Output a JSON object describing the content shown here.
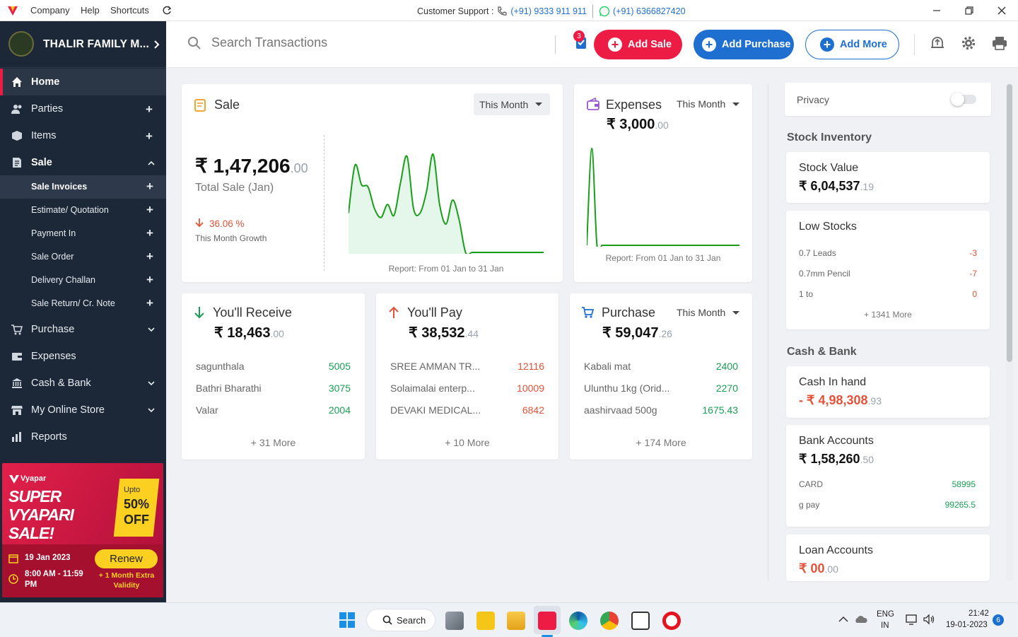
{
  "window": {
    "menu": [
      "Company",
      "Help",
      "Shortcuts"
    ],
    "support_label": "Customer Support :",
    "support_phone": "(+91) 9333 911 911",
    "support_whatsapp": "(+91) 6366827420"
  },
  "sidebar": {
    "company_name": "THALIR FAMILY M...",
    "items": [
      {
        "label": "Home",
        "icon": "home-icon"
      },
      {
        "label": "Parties",
        "icon": "people-icon"
      },
      {
        "label": "Items",
        "icon": "box-icon"
      },
      {
        "label": "Sale",
        "icon": "invoice-icon"
      },
      {
        "label": "Purchase",
        "icon": "cart-icon"
      },
      {
        "label": "Expenses",
        "icon": "wallet-icon"
      },
      {
        "label": "Cash & Bank",
        "icon": "bank-icon"
      },
      {
        "label": "My Online Store",
        "icon": "store-icon"
      },
      {
        "label": "Reports",
        "icon": "chart-icon"
      }
    ],
    "sale_sub": [
      "Sale Invoices",
      "Estimate/ Quotation",
      "Payment In",
      "Sale Order",
      "Delivery Challan",
      "Sale Return/ Cr. Note"
    ],
    "promo": {
      "brand": "Vyapar",
      "headline1": "SUPER",
      "headline2": "VYAPARI",
      "headline3": "SALE!",
      "offer_upto": "Upto",
      "offer_pct": "50%",
      "offer_off": "OFF",
      "date": "19 Jan 2023",
      "time": "8:00 AM - 11:59 PM",
      "renew": "Renew",
      "extra": "+ 1 Month Extra Validity"
    }
  },
  "topbar": {
    "search_placeholder": "Search Transactions",
    "notif_count": "3",
    "add_sale": "Add Sale",
    "add_purchase": "Add Purchase",
    "add_more": "Add More"
  },
  "sale": {
    "title": "Sale",
    "period": "This Month",
    "total_main": "₹ 1,47,206",
    "total_dec": ".00",
    "total_label": "Total Sale (Jan)",
    "growth": "36.06 %",
    "growth_label": "This Month Growth",
    "report": "Report: From 01 Jan to 31 Jan"
  },
  "expenses": {
    "title": "Expenses",
    "period": "This Month",
    "amount_main": "₹ 3,000",
    "amount_dec": ".00",
    "report": "Report: From 01 Jan to 31 Jan"
  },
  "receive": {
    "title": "You'll Receive",
    "amount_main": "₹ 18,463",
    "amount_dec": ".00",
    "rows": [
      {
        "name": "sagunthala",
        "value": "5005"
      },
      {
        "name": "Bathri Bharathi",
        "value": "3075"
      },
      {
        "name": "Valar",
        "value": "2004"
      }
    ],
    "more": "+ 31 More"
  },
  "pay": {
    "title": "You'll Pay",
    "amount_main": "₹ 38,532",
    "amount_dec": ".44",
    "rows": [
      {
        "name": "SREE AMMAN TR...",
        "value": "12116"
      },
      {
        "name": "Solaimalai enterp...",
        "value": "10009"
      },
      {
        "name": "DEVAKI MEDICAL...",
        "value": "6842"
      }
    ],
    "more": "+ 10 More"
  },
  "purchase": {
    "title": "Purchase",
    "period": "This Month",
    "amount_main": "₹ 59,047",
    "amount_dec": ".26",
    "rows": [
      {
        "name": "Kabali mat",
        "value": "2400"
      },
      {
        "name": "Ulunthu 1kg (Orid...",
        "value": "2270"
      },
      {
        "name": "aashirvaad 500g",
        "value": "1675.43"
      }
    ],
    "more": "+ 174 More"
  },
  "right": {
    "privacy": "Privacy",
    "stock_title": "Stock Inventory",
    "stock_value_label": "Stock Value",
    "stock_value_main": "₹ 6,04,537",
    "stock_value_dec": ".19",
    "low_stocks_label": "Low Stocks",
    "low_stocks": [
      {
        "name": "0.7 Leads",
        "value": "-3"
      },
      {
        "name": "0.7mm Pencil",
        "value": "-7"
      },
      {
        "name": "1 to",
        "value": "0"
      }
    ],
    "low_more": "+ 1341 More",
    "cash_title": "Cash & Bank",
    "cash_label": "Cash In hand",
    "cash_main": "- ₹ 4,98,308",
    "cash_dec": ".93",
    "bank_label": "Bank Accounts",
    "bank_main": "₹ 1,58,260",
    "bank_dec": ".50",
    "banks": [
      {
        "name": "CARD",
        "value": "58995"
      },
      {
        "name": "g pay",
        "value": "99265.5"
      }
    ],
    "loan_label": "Loan Accounts",
    "loan_main": "₹ 00",
    "loan_dec": ".00"
  },
  "taskbar": {
    "search": "Search",
    "lang1": "ENG",
    "lang2": "IN",
    "time": "21:42",
    "date": "19-01-2023",
    "notif": "6"
  },
  "colors": {
    "sidebar": "#1c2838",
    "accent": "#ed1c45",
    "blue": "#1f6fd1",
    "green": "#1a9e55",
    "red": "#e4523a"
  },
  "chart_data": [
    {
      "type": "area",
      "title": "",
      "x": [
        "1",
        "2",
        "3",
        "4",
        "5",
        "6",
        "7",
        "8",
        "9",
        "10",
        "11",
        "12",
        "13",
        "14",
        "15",
        "16",
        "17",
        "18",
        "19",
        "20",
        "21",
        "22",
        "23",
        "24",
        "25",
        "26",
        "27",
        "28",
        "29",
        "30",
        "31"
      ],
      "values": [
        18000,
        40000,
        31000,
        30000,
        20000,
        16000,
        22000,
        17000,
        32000,
        44000,
        20000,
        18000,
        28000,
        45000,
        22000,
        13000,
        24000,
        15000,
        0,
        0,
        0,
        0,
        0,
        0,
        0,
        0,
        0,
        0,
        0,
        0,
        0
      ],
      "color": "#1a9e1a"
    },
    {
      "type": "line",
      "title": "",
      "x": [
        "1",
        "2",
        "3",
        "4",
        "5",
        "6",
        "7",
        "8",
        "9",
        "10",
        "11",
        "12",
        "13",
        "14",
        "15",
        "16",
        "17",
        "18",
        "19",
        "20",
        "21",
        "22",
        "23",
        "24",
        "25",
        "26",
        "27",
        "28",
        "29",
        "30",
        "31"
      ],
      "values": [
        0,
        3000,
        0,
        0,
        0,
        0,
        0,
        0,
        0,
        0,
        0,
        0,
        0,
        0,
        0,
        0,
        0,
        0,
        0,
        0,
        0,
        0,
        0,
        0,
        0,
        0,
        0,
        0,
        0,
        0,
        0
      ],
      "color": "#1a9e1a"
    }
  ]
}
